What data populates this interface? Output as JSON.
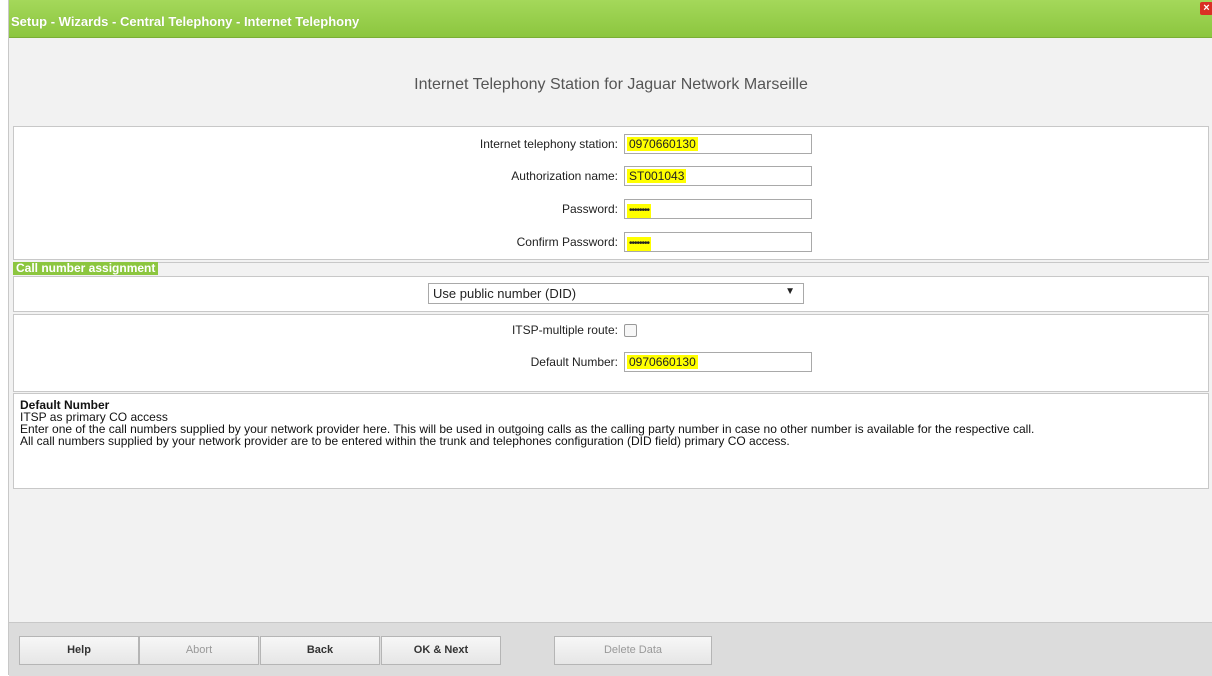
{
  "window": {
    "title": "Setup - Wizards - Central Telephony - Internet Telephony",
    "close_label": "×"
  },
  "heading": "Internet Telephony Station for Jaguar Network Marseille",
  "credentials": {
    "station_label": "Internet telephony station:",
    "station_value": "0970660130",
    "auth_label": "Authorization name:",
    "auth_value": "ST001043",
    "password_label": "Password:",
    "password_value": "••••••••",
    "confirm_label": "Confirm Password:",
    "confirm_value": "••••••••"
  },
  "call_assignment": {
    "section_title": "Call number assignment",
    "selected": "Use public number (DID)"
  },
  "routing": {
    "multiple_route_label": "ITSP-multiple route:",
    "multiple_route_checked": false,
    "default_number_label": "Default Number:",
    "default_number_value": "0970660130"
  },
  "help": {
    "title": "Default Number",
    "line1": "ITSP as primary CO access",
    "line2": "Enter one of the call numbers supplied by your network provider here. This will be used in outgoing calls as the calling party number in case no other number is available for the respective call.",
    "line3": "All call numbers supplied by your network provider are to be entered within the trunk and telephones configuration (DID field) primary CO access."
  },
  "buttons": {
    "help": "Help",
    "abort": "Abort",
    "back": "Back",
    "ok_next": "OK & Next",
    "delete": "Delete Data"
  },
  "colors": {
    "accent": "#8cc63f",
    "highlight": "#ffff00",
    "close": "#d93025"
  }
}
